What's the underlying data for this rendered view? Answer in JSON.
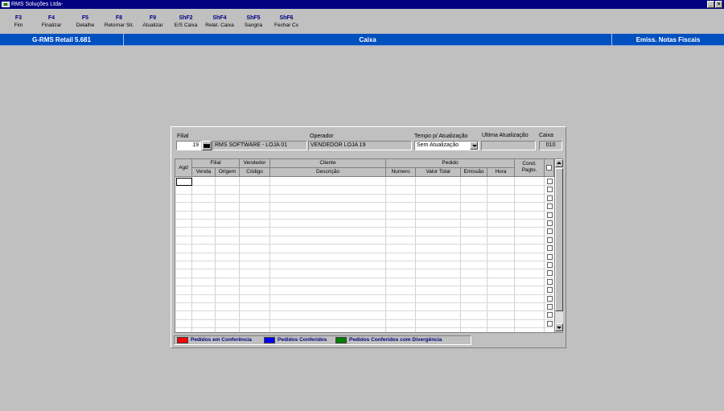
{
  "window": {
    "title": "RMS Soluções Ltda-",
    "minimize_glyph": "_",
    "close_glyph": "×"
  },
  "toolbar": [
    {
      "key": "F3",
      "label": "Fim"
    },
    {
      "key": "F4",
      "label": "Finalizar"
    },
    {
      "key": "F5",
      "label": "Detalhe"
    },
    {
      "key": "F8",
      "label": "Retornar Sit."
    },
    {
      "key": "F9",
      "label": "Atualizar"
    },
    {
      "key": "ShF2",
      "label": "E/S Caixa"
    },
    {
      "key": "ShF4",
      "label": "Relat. Caixa"
    },
    {
      "key": "ShF5",
      "label": "Sangria"
    },
    {
      "key": "ShF6",
      "label": "Fechar Cx"
    }
  ],
  "statusbar": {
    "left": "G-RMS Retail 5.681",
    "center": "Caixa",
    "right": "Emiss. Notas Fiscais"
  },
  "form": {
    "filial_label": "Filial",
    "filial_code": "19",
    "filial_name": "RMS SOFTWARE - LOJA 01",
    "operador_label": "Operador",
    "operador_value": "VENDEDOR LOJA 19",
    "tempo_label": "Tempo p/ Atualização",
    "tempo_value": "Sem Atualização",
    "ultima_label": "Ultima Atualização",
    "ultima_value": "",
    "caixa_label": "Caixa",
    "caixa_value": "010"
  },
  "grid": {
    "group_headers": {
      "agd": "Agd",
      "filial": "Filial",
      "vendedor": "Vendedor",
      "cliente": "Cliente",
      "pedido": "Pedido",
      "cond": "Cond. Pagto."
    },
    "sub_headers": {
      "venda": "Venda",
      "origem": "Origem",
      "codigo": "Código",
      "descricao": "Descrição",
      "numero": "Numero",
      "valor_total": "Valor Total",
      "emissao": "Emissão",
      "hora": "Hora"
    },
    "rows": 18
  },
  "legend": [
    {
      "label": "Pedidos em Conferência",
      "color": "#ff0000"
    },
    {
      "label": "Pedidos Conferidos",
      "color": "#0000ff"
    },
    {
      "label": "Pedidos Conferidos com Divergência",
      "color": "#008000"
    }
  ]
}
